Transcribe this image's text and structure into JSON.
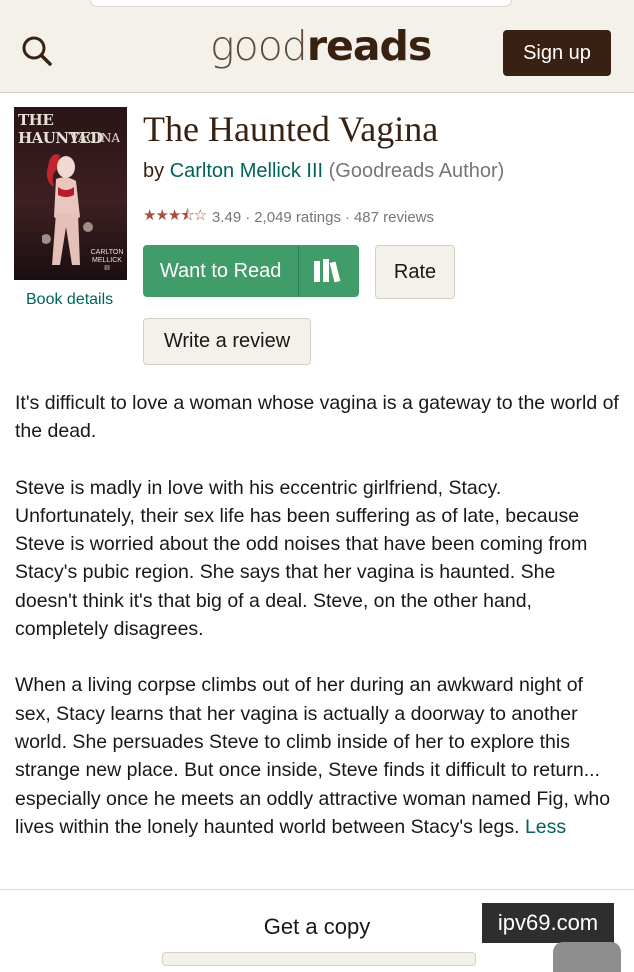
{
  "header": {
    "logo_light": "good",
    "logo_bold": "reads",
    "signup_label": "Sign up",
    "icons": {
      "search": "search-icon"
    }
  },
  "book": {
    "cover_title_line1": "THE HAUNTED",
    "cover_title_line2": "VAGINA",
    "cover_author": "CARLTON MELLICK III",
    "book_details_label": "Book details",
    "title": "The Haunted Vagina",
    "by_prefix": "by",
    "author": "Carlton Mellick III",
    "author_role": "(Goodreads Author)",
    "rating": 3.49,
    "rating_text": "3.49",
    "ratings_text": "2,049 ratings",
    "reviews_text": "487 reviews",
    "separator": "·",
    "stars_full": "★★★",
    "stars_half": "⯪",
    "stars_empty": "☆"
  },
  "actions": {
    "want_to_read": "Want to Read",
    "rate": "Rate",
    "write_review": "Write a review",
    "icons": {
      "shelf": "bookshelf-icon"
    },
    "colors": {
      "want_to_read_bg": "#409d69"
    }
  },
  "description": {
    "p1": "It's difficult to love a woman whose vagina is a gateway to the world of the dead.",
    "p2": "Steve is madly in love with his eccentric girlfriend, Stacy. Unfortunately, their sex life has been suffering as of late, because Steve is worried about the odd noises that have been coming from Stacy's pubic region. She says that her vagina is haunted. She doesn't think it's that big of a deal. Steve, on the other hand, completely disagrees.",
    "p3": "When a living corpse climbs out of her during an awkward night of sex, Stacy learns that her vagina is actually a doorway to another world. She persuades Steve to climb inside of her to explore this strange new place. But once inside, Steve finds it difficult to return... especially once he meets an oddly attractive woman named Fig, who lives within the lonely haunted world between Stacy's legs.",
    "less_label": "Less"
  },
  "footer": {
    "get_copy": "Get a copy",
    "watermark": "ipv69.com"
  }
}
